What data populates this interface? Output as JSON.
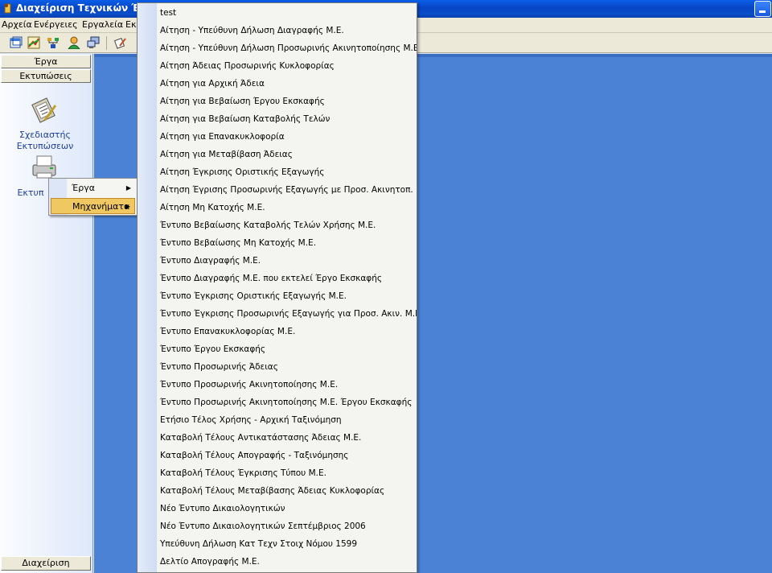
{
  "window": {
    "title": "Διαχείριση Τεχνικών Έργ"
  },
  "menubar": {
    "items": [
      "Αρχεία",
      "Ενέργειες",
      "Εργαλεία",
      "Εκ"
    ]
  },
  "left_panel": {
    "groups": [
      "Έργα",
      "Εκτυπώσεις"
    ],
    "items": [
      {
        "label_line1": "Σχεδιαστής",
        "label_line2": "Εκτυπώσεων",
        "icon": "clipboard-pencil-icon"
      },
      {
        "label": "Εκτυπ",
        "icon": "printer-icon"
      }
    ],
    "bottom_button": "Διαχείριση"
  },
  "context_menu": {
    "items": [
      {
        "label": "Έργα",
        "has_submenu": true,
        "selected": false
      },
      {
        "label": "Μηχανήματα",
        "has_submenu": true,
        "selected": true
      }
    ]
  },
  "submenu": {
    "items": [
      "test",
      "Αίτηση - Υπεύθυνη Δήλωση Διαγραφής Μ.Ε.",
      "Αίτηση - Υπεύθυνη Δήλωση Προσωρινής Ακινητοποίησης Μ.Ε.",
      "Αίτηση Άδειας Προσωρινής Κυκλοφορίας",
      "Αίτηση για Αρχική Άδεια",
      "Αίτηση για Βεβαίωση Έργου Εκσκαφής",
      "Αίτηση για Βεβαίωση Καταβολής Τελών",
      "Αίτηση για Επανακυκλοφορία",
      "Αίτηση για Μεταβίβαση Άδειας",
      "Αίτηση Έγκρισης Οριστικής Εξαγωγής",
      "Αίτηση Έγρισης Προσωρινής Εξαγωγής με Προσ. Ακινητοπ.",
      "Αίτηση Μη Κατοχής Μ.Ε.",
      "Έντυπο Βεβαίωσης Καταβολής Τελών Χρήσης Μ.Ε.",
      "Έντυπο Βεβαίωσης Μη Κατοχής Μ.Ε.",
      "Έντυπο Διαγραφής Μ.Ε.",
      "Έντυπο Διαγραφής Μ.Ε. που εκτελεί Έργο Εκσκαφής",
      "Έντυπο Έγκρισης Οριστικής Εξαγωγής Μ.Ε.",
      "Έντυπο Έγκρισης Προσωρινής Εξαγωγής για Προσ. Ακιν. Μ.Ε.",
      "Έντυπο Επανακυκλοφορίας Μ.Ε.",
      "Έντυπο Έργου Εκσκαφής",
      "Έντυπο Προσωρινής Άδειας",
      "Έντυπο Προσωρινής Ακινητοποίησης Μ.Ε.",
      "Έντυπο Προσωρινής Ακινητοποίησης Μ.Ε. Έργου Εκσκαφής",
      "Ετήσιο Τέλος Χρήσης - Αρχική Ταξινόμηση",
      "Καταβολή Τέλους Αντικατάστασης Άδειας Μ.Ε.",
      "Καταβολή Τέλους Απογραφής - Ταξινόμησης",
      "Καταβολή Τέλους Έγκρισης Τύπου Μ.Ε.",
      "Καταβολή Τέλους Μεταβίβασης Άδειας Κυκλοφορίας",
      "Νέο Έντυπο Δικαιολογητικών",
      "Νέο Έντυπο Δικαιολογητικών Σεπτέμβριος 2006",
      "Υπεύθυνη Δήλωση Κατ  Τεχν Στοιχ  Νόμου 1599",
      "Δελτίο Απογραφής Μ.Ε."
    ]
  },
  "colors": {
    "titlebar": "#0845c6",
    "desktop": "#4b82d5",
    "highlight": "#f0c862"
  }
}
